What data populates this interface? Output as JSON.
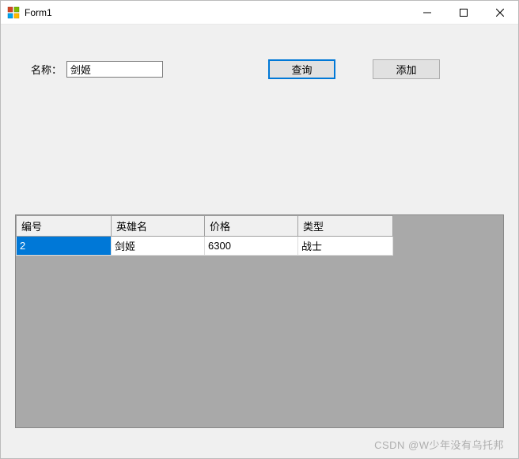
{
  "window": {
    "title": "Form1"
  },
  "form": {
    "name_label": "名称：",
    "name_value": "剑姬",
    "query_button": "查询",
    "add_button": "添加"
  },
  "grid": {
    "columns": [
      "编号",
      "英雄名",
      "价格",
      "类型"
    ],
    "rows": [
      {
        "id": "2",
        "name": "剑姬",
        "price": "6300",
        "type": "战士",
        "selected_col": 0
      }
    ]
  },
  "watermark": "CSDN @W少年没有乌托邦"
}
